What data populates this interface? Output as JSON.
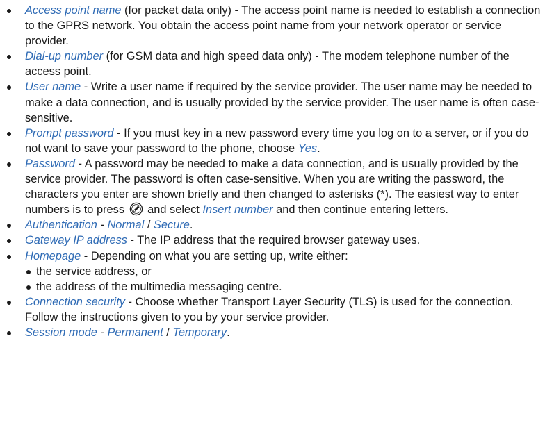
{
  "items": [
    {
      "term": "Access point name",
      "text": " (for packet data only) - The access point name is needed to establish a connection to the GPRS network. You obtain the access point name from your network operator or service provider."
    },
    {
      "term": "Dial-up number",
      "text": " (for GSM data and high speed data only) - The modem telephone number of the access point."
    },
    {
      "term": "User name",
      "text": " - Write a user name if required by the service provider. The user name may be needed to make a data connection, and is usually provided by the service provider. The user name is often case-sensitive."
    },
    {
      "term": "Prompt password",
      "text": " - If you must key in a new password every time you log on to a server, or if you do not want to save your password to the phone, choose ",
      "term2": "Yes",
      "text2": "."
    },
    {
      "term": "Password",
      "text": " - A password may be needed to make a data connection, and is usually provided by the service provider. The password is often case-sensitive. When you are writing the password, the characters you enter are shown briefly and then changed to asterisks (*). The easiest way to enter numbers is to press",
      "text_after_icon": " and select ",
      "term2": "Insert number",
      "text2": " and then continue entering letters.",
      "icon": "pencil-key-icon"
    },
    {
      "term": "Authentication",
      "text": " - ",
      "opt1": "Normal",
      "sep": " / ",
      "opt2": "Secure",
      "end": "."
    },
    {
      "term": "Gateway IP address",
      "text": " - The IP address that the required browser gateway uses."
    },
    {
      "term": "Homepage",
      "text": " - Depending on what you are setting up, write either:",
      "subitems": [
        "the service address, or",
        "the address of the multimedia messaging centre."
      ]
    },
    {
      "term": "Connection security",
      "text": " - Choose whether Transport Layer Security (TLS) is used for the connection. Follow the instructions given to you by your service provider."
    },
    {
      "term": "Session mode",
      "text": " - ",
      "opt1": "Permanent",
      "sep": " / ",
      "opt2": "Temporary",
      "end": "."
    }
  ],
  "colors": {
    "term": "#2f6bb5",
    "text": "#1a1a1a"
  }
}
